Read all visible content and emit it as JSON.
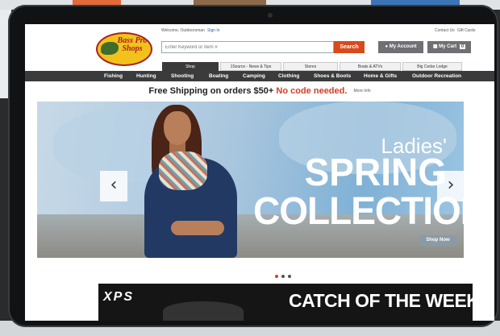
{
  "header": {
    "welcome_text": "Welcome, Outdoorsman",
    "sign_in": "Sign In",
    "contact_us": "Contact Us",
    "gift_cards": "Gift Cards",
    "logo_text": "Bass Pro Shops",
    "search_placeholder": "Enter Keyword or Item #",
    "search_button": "Search",
    "my_account": "My Account",
    "my_cart": "My Cart",
    "cart_count": "0"
  },
  "tabs": [
    {
      "label": "Shop",
      "active": true
    },
    {
      "label": "1Source - News & Tips",
      "active": false
    },
    {
      "label": "Stores",
      "active": false
    },
    {
      "label": "Boats & ATVs",
      "active": false
    },
    {
      "label": "Big Cedar Lodge",
      "active": false
    }
  ],
  "nav": {
    "items": [
      "Fishing",
      "Hunting",
      "Shooting",
      "Boating",
      "Camping",
      "Clothing",
      "Shoes & Boots",
      "Home & Gifts",
      "Outdoor Recreation"
    ]
  },
  "shipping": {
    "text": "Free Shipping on orders $50+",
    "highlight": "No code needed.",
    "more_info": "More Info"
  },
  "hero": {
    "line1": "Ladies'",
    "line2": "SPRING",
    "line3": "COLLECTION",
    "cta": "Shop Now",
    "prev": "‹",
    "next": "›"
  },
  "carousel": {
    "dots": 3,
    "active_index": 0
  },
  "promo": {
    "brand": "XPS",
    "title": "CATCH OF THE WEEK"
  },
  "colors": {
    "accent": "#d84a1b",
    "nav_bg": "#3a3b3c",
    "highlight_red": "#d23d26",
    "logo_yellow": "#f3c11c"
  }
}
